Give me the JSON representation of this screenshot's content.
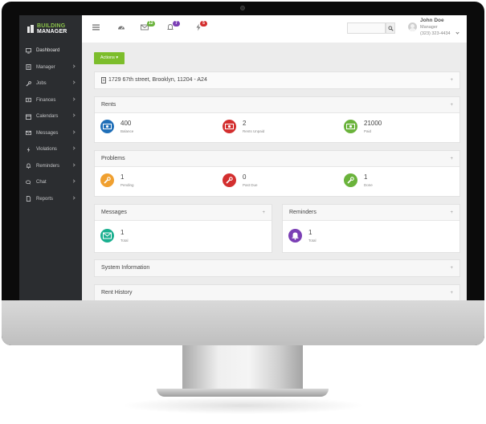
{
  "app": {
    "logo_line1": "BUILDING",
    "logo_line2": "MANAGER"
  },
  "sidebar": {
    "items": [
      {
        "label": "Dashboard",
        "icon": "monitor-icon",
        "has_arrow": false
      },
      {
        "label": "Manager",
        "icon": "document-icon",
        "has_arrow": true
      },
      {
        "label": "Jobs",
        "icon": "wrench-icon",
        "has_arrow": true
      },
      {
        "label": "Finances",
        "icon": "money-icon",
        "has_arrow": true
      },
      {
        "label": "Calendars",
        "icon": "calendar-icon",
        "has_arrow": true
      },
      {
        "label": "Messages",
        "icon": "envelope-icon",
        "has_arrow": true
      },
      {
        "label": "Violations",
        "icon": "bolt-icon",
        "has_arrow": true
      },
      {
        "label": "Reminders",
        "icon": "bell-icon",
        "has_arrow": true
      },
      {
        "label": "Chat",
        "icon": "chat-icon",
        "has_arrow": true
      },
      {
        "label": "Reports",
        "icon": "file-icon",
        "has_arrow": true
      }
    ]
  },
  "topbar": {
    "messages_badge": "12",
    "notifications_badge": "7",
    "violations_badge": "5",
    "user": {
      "name": "John Doe",
      "role": "Manager",
      "phone": "(323) 323-4434"
    }
  },
  "main": {
    "actions_label": "Actions",
    "address": "1729 67th street, Brooklyn, 11204 - A24",
    "rents": {
      "title": "Rents",
      "stats": [
        {
          "value": "400",
          "label": "Balance",
          "color": "#1f6fb8",
          "icon": "money-icon"
        },
        {
          "value": "2",
          "label": "Rents Unpaid",
          "color": "#d32f2f",
          "icon": "money-icon"
        },
        {
          "value": "21000",
          "label": "Paid",
          "color": "#6ab33b",
          "icon": "money-icon"
        }
      ]
    },
    "problems": {
      "title": "Problems",
      "stats": [
        {
          "value": "1",
          "label": "Pending",
          "color": "#f0a030",
          "icon": "wrench-icon"
        },
        {
          "value": "0",
          "label": "Past Due",
          "color": "#d32f2f",
          "icon": "wrench-icon"
        },
        {
          "value": "1",
          "label": "Done",
          "color": "#6ab33b",
          "icon": "wrench-icon"
        }
      ]
    },
    "messages": {
      "title": "Messages",
      "value": "1",
      "label": "Total",
      "color": "#1aaf8f",
      "icon": "envelope-icon"
    },
    "reminders": {
      "title": "Reminders",
      "value": "1",
      "label": "Total",
      "color": "#7b3fb5",
      "icon": "bell-icon"
    },
    "system_info": {
      "title": "System Information"
    },
    "rent_history": {
      "title": "Rent History"
    }
  },
  "colors": {
    "accent_green": "#7cbd2b",
    "sidebar_bg": "#2b2d30",
    "badge_green": "#6ab33b",
    "badge_purple": "#7b3fb5",
    "badge_red": "#d32f2f"
  }
}
